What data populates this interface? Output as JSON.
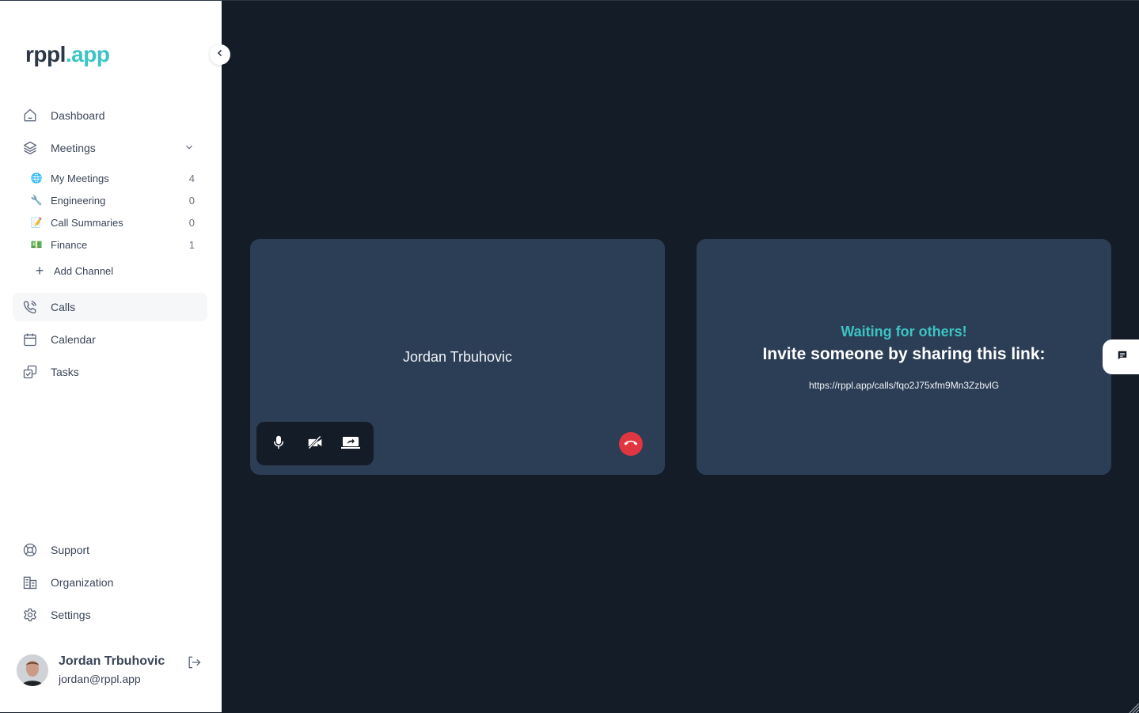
{
  "brand": {
    "name_part1": "rppl",
    "name_part2": ".app"
  },
  "sidebar": {
    "collapse_icon": "chevron-left-icon",
    "nav": [
      {
        "label": "Dashboard",
        "icon": "home-icon"
      },
      {
        "label": "Meetings",
        "icon": "layers-icon",
        "expanded": true
      },
      {
        "label": "Calls",
        "icon": "phone-call-icon",
        "active": true
      },
      {
        "label": "Calendar",
        "icon": "calendar-icon"
      },
      {
        "label": "Tasks",
        "icon": "tasks-icon"
      }
    ],
    "channels": [
      {
        "emoji": "🌐",
        "label": "My Meetings",
        "count": "4"
      },
      {
        "emoji": "🔧",
        "label": "Engineering",
        "count": "0"
      },
      {
        "emoji": "📝",
        "label": "Call Summaries",
        "count": "0"
      },
      {
        "emoji": "💵",
        "label": "Finance",
        "count": "1"
      }
    ],
    "add_channel_label": "Add Channel",
    "bottom_nav": [
      {
        "label": "Support",
        "icon": "lifebuoy-icon"
      },
      {
        "label": "Organization",
        "icon": "building-icon"
      },
      {
        "label": "Settings",
        "icon": "gear-icon"
      }
    ],
    "user": {
      "name": "Jordan Trbuhovic",
      "email": "jordan@rppl.app"
    }
  },
  "call": {
    "self_tile": {
      "participant_name": "Jordan Trbuhovic",
      "controls": [
        "microphone-icon",
        "camera-off-icon",
        "share-screen-icon"
      ],
      "hangup_icon": "hang-up-icon"
    },
    "invite_tile": {
      "waiting_text": "Waiting for others!",
      "invite_text": "Invite someone by sharing this link:",
      "link": "https://rppl.app/calls/fqo2J75xfm9Mn3ZzbvlG"
    }
  },
  "colors": {
    "accent": "#3cc4c4",
    "background": "#141c27",
    "tile": "#2c3e56",
    "hangup": "#e0363f"
  }
}
